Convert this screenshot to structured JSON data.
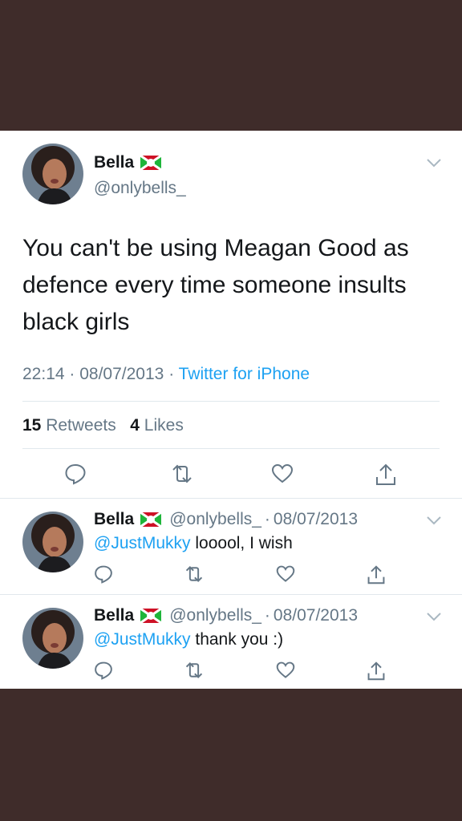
{
  "tweet": {
    "name": "Bella",
    "handle": "@onlybells_",
    "text": "You can't be using Meagan Good as defence every time someone insults black girls",
    "time": "22:14",
    "date": "08/07/2013",
    "source": "Twitter for iPhone",
    "retweets_count": "15",
    "retweets_label": "Retweets",
    "likes_count": "4",
    "likes_label": "Likes"
  },
  "replies": [
    {
      "name": "Bella",
      "handle": "@onlybells_",
      "date": "08/07/2013",
      "mention": "@JustMukky",
      "text": "looool, I wish"
    },
    {
      "name": "Bella",
      "handle": "@onlybells_",
      "date": "08/07/2013",
      "mention": "@JustMukky",
      "text": "thank you :)"
    }
  ],
  "icons": {
    "reply": "reply-icon",
    "retweet": "retweet-icon",
    "like": "heart-icon",
    "share": "share-icon",
    "caret": "chevron-down-icon",
    "flag": "burundi-flag-icon"
  },
  "colors": {
    "background": "#3f2c2a",
    "link": "#1da1f2",
    "secondary": "#657786"
  }
}
